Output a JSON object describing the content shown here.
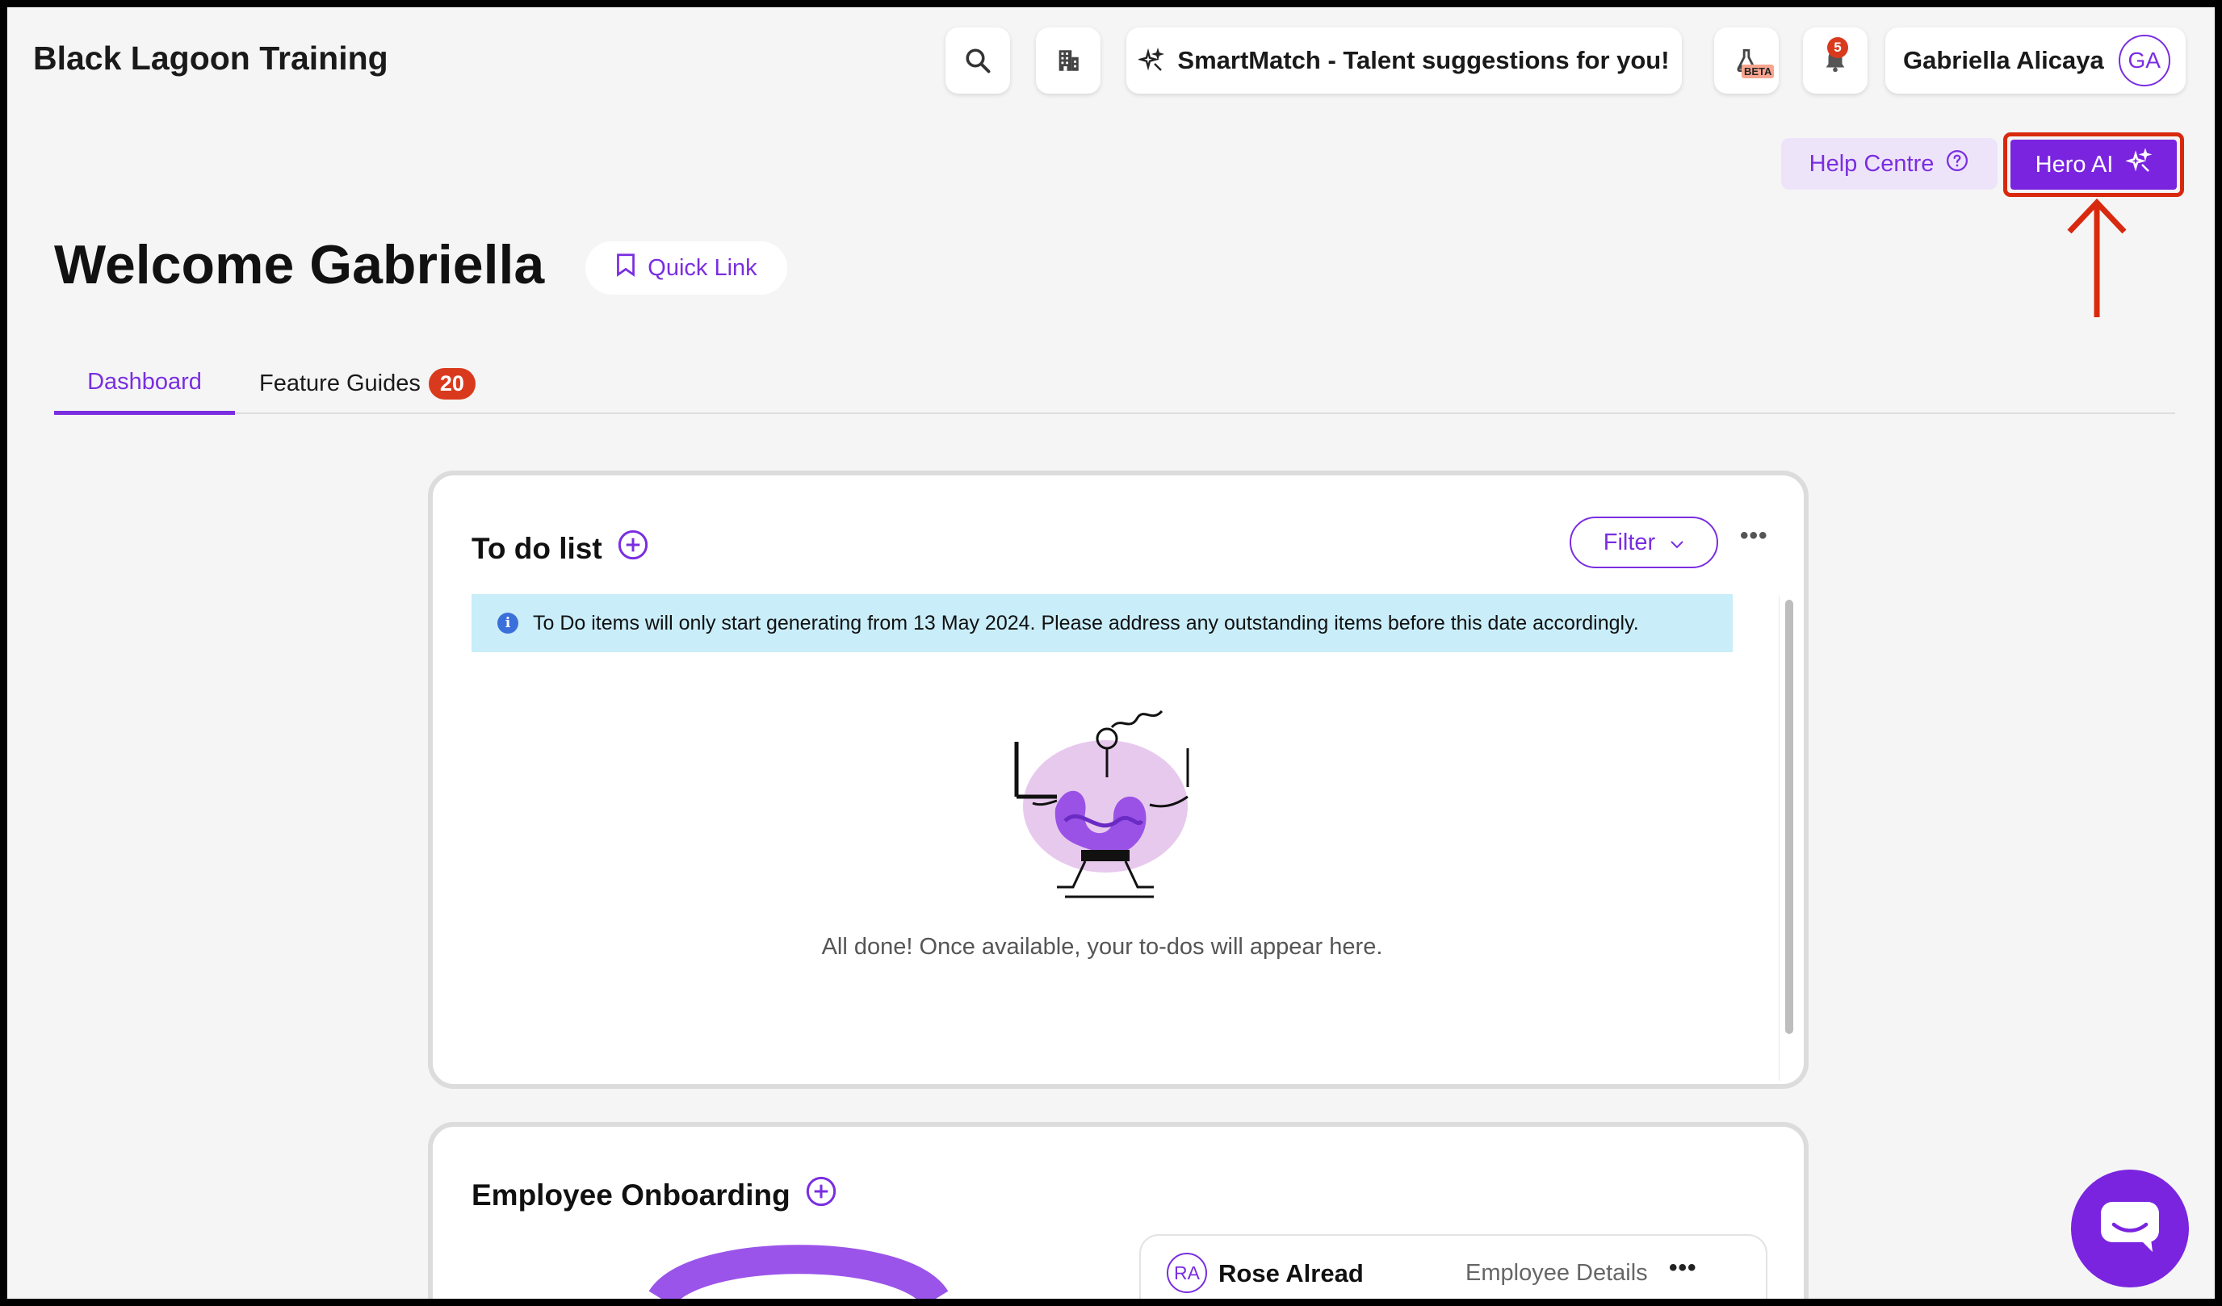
{
  "header": {
    "company": "Black Lagoon Training",
    "smartmatch_label": "SmartMatch - Talent suggestions for you!",
    "beta_label": "BETA",
    "notification_count": "5",
    "user_name": "Gabriella Alicaya",
    "user_initials": "GA"
  },
  "actions": {
    "help_label": "Help Centre",
    "hero_label": "Hero AI"
  },
  "page": {
    "welcome": "Welcome Gabriella",
    "quick_link": "Quick Link"
  },
  "tabs": [
    {
      "label": "Dashboard",
      "active": true
    },
    {
      "label": "Feature Guides",
      "badge": "20"
    }
  ],
  "todo": {
    "title": "To do list",
    "filter_label": "Filter",
    "notice": "To Do items will only start generating from 13 May 2024. Please address any outstanding items before this date accordingly.",
    "empty_message": "All done! Once available, your to-dos will appear here."
  },
  "onboarding": {
    "title": "Employee Onboarding",
    "employee_initials": "RA",
    "employee_name": "Rose Alread",
    "details_label": "Employee Details"
  },
  "colors": {
    "brand_purple": "#7a24e0",
    "badge_red": "#d93a1e",
    "highlight_red": "#d8290e",
    "info_bg": "#c9edf9"
  }
}
